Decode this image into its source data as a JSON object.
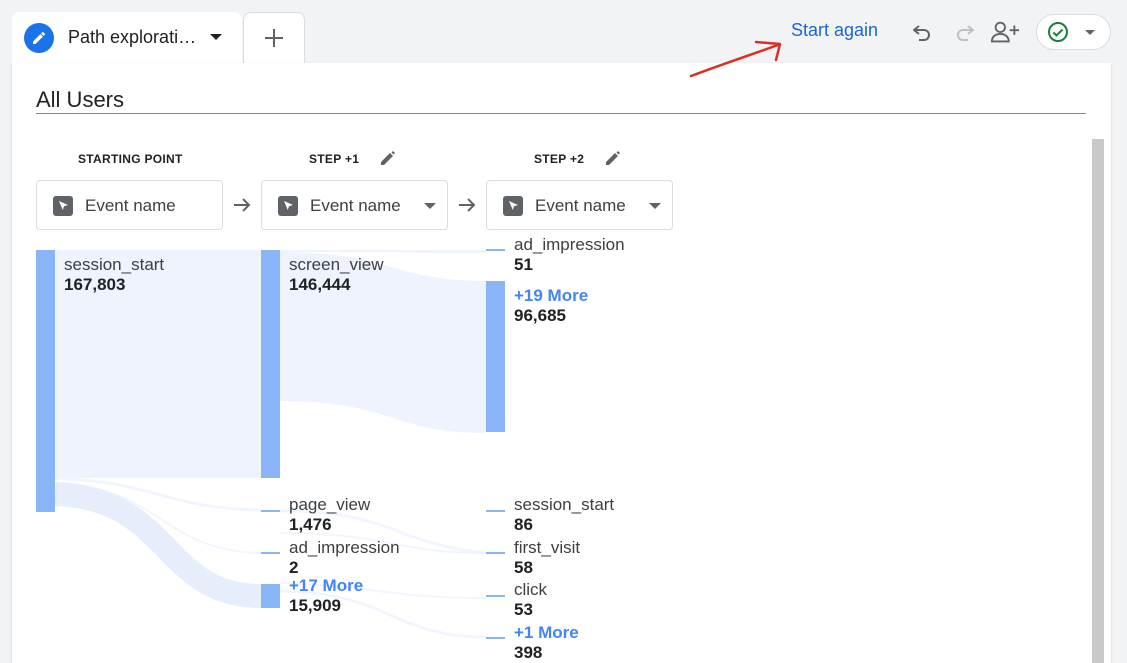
{
  "tabs": {
    "active_label": "Path explorati…",
    "add_symbol": "+"
  },
  "toolbar": {
    "start_again": "Start again",
    "icons": [
      "undo-icon",
      "redo-icon",
      "share-user-icon",
      "check-circle-icon"
    ]
  },
  "segment": {
    "title": "All Users"
  },
  "columns": [
    {
      "header": "STARTING POINT",
      "dimension": "Event name",
      "has_dropdown": false
    },
    {
      "header": "STEP +1",
      "dimension": "Event name",
      "has_dropdown": true
    },
    {
      "header": "STEP +2",
      "dimension": "Event name",
      "has_dropdown": true
    }
  ],
  "nodes": {
    "start": [
      {
        "name": "session_start",
        "value": "167,803"
      }
    ],
    "step1": [
      {
        "name": "screen_view",
        "value": "146,444"
      },
      {
        "name": "page_view",
        "value": "1,476"
      },
      {
        "name": "ad_impression",
        "value": "2"
      },
      {
        "more": "+17 More",
        "value": "15,909"
      }
    ],
    "step2": [
      {
        "name": "ad_impression",
        "value": "51"
      },
      {
        "more": "+19 More",
        "value": "96,685"
      },
      {
        "name": "session_start",
        "value": "86"
      },
      {
        "name": "first_visit",
        "value": "58"
      },
      {
        "name": "click",
        "value": "53"
      },
      {
        "more": "+1 More",
        "value": "398"
      }
    ]
  },
  "colors": {
    "accent": "#1a73e8",
    "node_bar": "#8ab4f8",
    "flow": "#e8f0fe",
    "more_link": "#4285f4",
    "annotation_arrow": "#d93025"
  }
}
